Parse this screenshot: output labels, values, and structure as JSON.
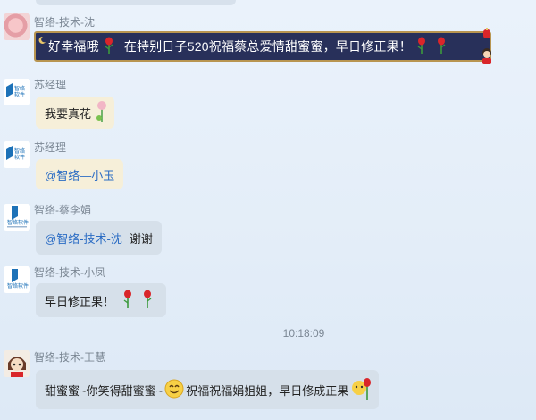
{
  "messages": [
    {
      "sender": "智络-技术-沈",
      "text": "好幸福哦 🌹 在特别日子520祝福蔡总爱情甜蜜蜜，早日修正果！",
      "parts": [
        "好幸福哦",
        "在特别日子520祝福蔡总爱情甜蜜蜜，早日修正果！"
      ]
    },
    {
      "sender": "苏经理",
      "text": "我要真花"
    },
    {
      "sender": "苏经理",
      "mention": "@智络—小玉"
    },
    {
      "sender": "智络-蔡李娟",
      "mention": "@智络-技术-沈",
      "text": "谢谢"
    },
    {
      "sender": "智络-技术-小凤",
      "text": "早日修正果！"
    },
    {
      "sender": "智络-技术-王慧",
      "parts": [
        "甜蜜蜜~你笑得甜蜜蜜~",
        "祝福祝福娟姐姐，早日修成正果"
      ]
    }
  ],
  "timestamp": "10:18:09",
  "icons": [
    "rose-icon",
    "smiley-icon",
    "rose-icon"
  ],
  "colors": {
    "mention": "#2b6cc4",
    "bubble": "#d6e0ea",
    "bubble_alt": "#f6efd9",
    "banner": "#28305a"
  }
}
